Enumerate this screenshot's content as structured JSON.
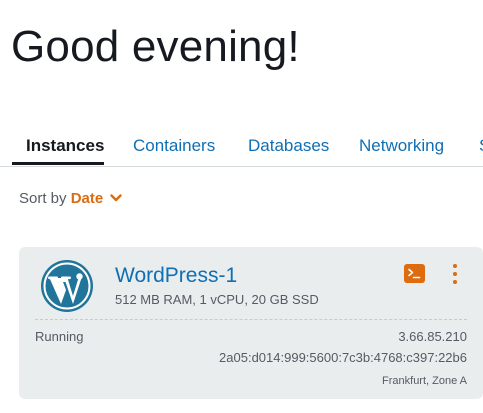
{
  "greeting": "Good evening!",
  "tabs": [
    {
      "label": "Instances",
      "active": true
    },
    {
      "label": "Containers",
      "active": false
    },
    {
      "label": "Databases",
      "active": false
    },
    {
      "label": "Networking",
      "active": false
    },
    {
      "label": "S",
      "active": false
    }
  ],
  "sort": {
    "label": "Sort by",
    "value": "Date",
    "icon": "chevron-down-icon"
  },
  "instance": {
    "name": "WordPress-1",
    "spec": "512 MB RAM, 1 vCPU, 20 GB SSD",
    "status": "Running",
    "ipv4": "3.66.85.210",
    "ipv6": "2a05:d014:999:5600:7c3b:4768:c397:22b6",
    "location": "Frankfurt, Zone A",
    "logo_icon": "wordpress-logo-icon",
    "connect_icon": "terminal-icon",
    "menu_icon": "kebab-menu-icon"
  },
  "colors": {
    "accent": "#dd6b10",
    "link": "#0f6fb4",
    "text": "#16191f",
    "muted": "#545b64",
    "card_bg": "#eaeded",
    "wordpress_blue": "#21759b"
  }
}
